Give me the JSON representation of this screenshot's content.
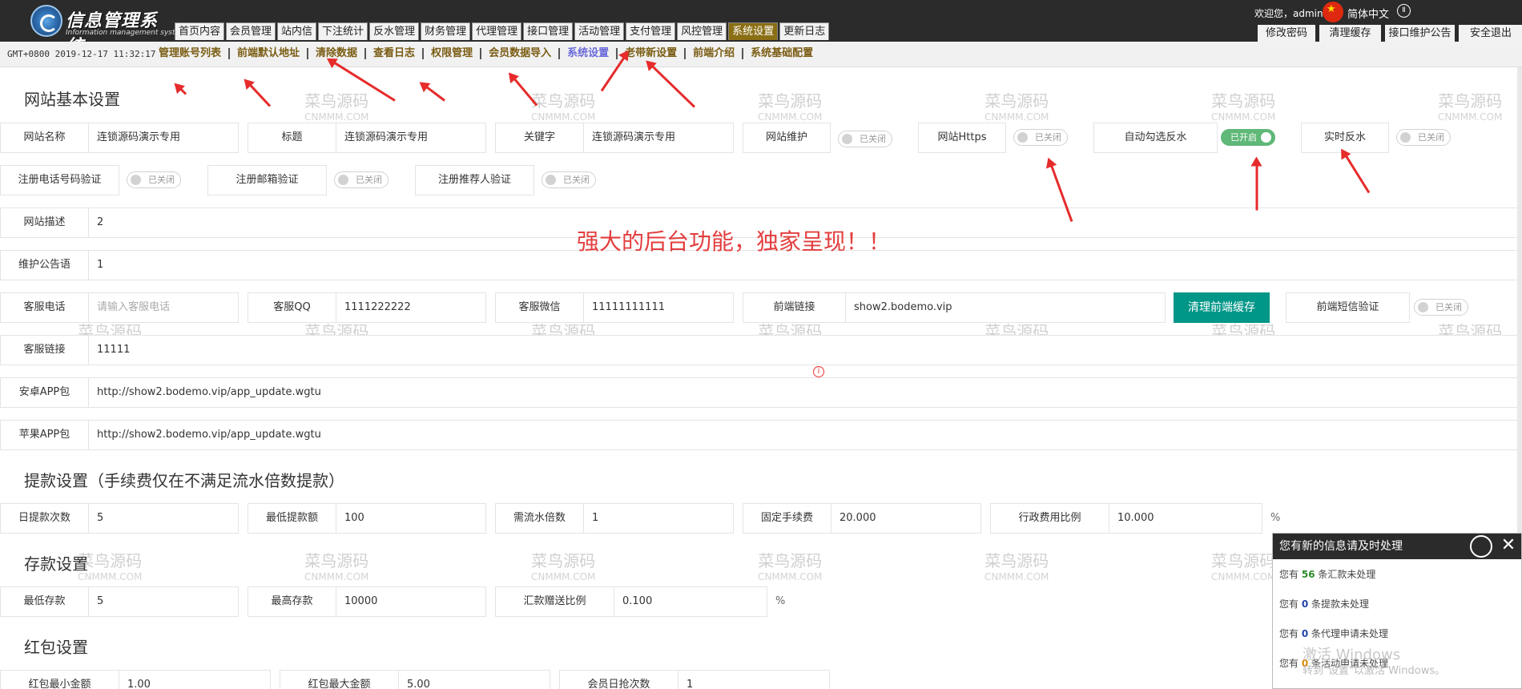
{
  "app": {
    "title": "信息管理系统",
    "subtitle": "Information management system"
  },
  "topnav": [
    "首页内容",
    "会员管理",
    "站内信",
    "下注统计",
    "反水管理",
    "财务管理",
    "代理管理",
    "接口管理",
    "活动管理",
    "支付管理",
    "风控管理",
    "系统设置",
    "更新日志"
  ],
  "user": {
    "welcome": "欢迎您，admin",
    "lang": "简体中文",
    "pause": "Ⅱ"
  },
  "top_buttons": [
    "修改密码",
    "清理缓存",
    "接口维护公告",
    "安全退出"
  ],
  "clock": "GMT+0800 2019-12-17 11:32:17",
  "subnav": [
    "管理账号列表",
    "前端默认地址",
    "清除数据",
    "查看日志",
    "权限管理",
    "会员数据导入",
    "系统设置",
    "老带新设置",
    "前端介绍",
    "系统基础配置"
  ],
  "sections": {
    "basic": "网站基本设置",
    "withdraw": "提款设置（手续费仅在不满足流水倍数提款）",
    "deposit": "存款设置",
    "redpack": "红包设置"
  },
  "basic": {
    "site_name": {
      "label": "网站名称",
      "value": "连锁源码演示专用"
    },
    "title": {
      "label": "标题",
      "value": "连锁源码演示专用"
    },
    "keywords": {
      "label": "关键字",
      "value": "连锁源码演示专用"
    },
    "maintenance": {
      "label": "网站维护",
      "state": "已关闭"
    },
    "https": {
      "label": "网站Https",
      "state": "已关闭"
    },
    "auto_rebate": {
      "label": "自动勾选反水",
      "state": "已开启"
    },
    "realtime_rebate": {
      "label": "实时反水",
      "state": "已关闭"
    },
    "phone_verify": {
      "label": "注册电话号码验证",
      "state": "已关闭"
    },
    "email_verify": {
      "label": "注册邮箱验证",
      "state": "已关闭"
    },
    "referrer_verify": {
      "label": "注册推荐人验证",
      "state": "已关闭"
    },
    "description": {
      "label": "网站描述",
      "value": "2"
    },
    "notice": {
      "label": "维护公告语",
      "value": "1"
    },
    "cs_phone": {
      "label": "客服电话",
      "placeholder": "请输入客服电话"
    },
    "cs_qq": {
      "label": "客服QQ",
      "value": "1111222222"
    },
    "cs_wechat": {
      "label": "客服微信",
      "value": "11111111111"
    },
    "frontend_link": {
      "label": "前端链接",
      "value": "show2.bodemo.vip"
    },
    "clear_frontend_cache": "清理前端缓存",
    "frontend_sms": {
      "label": "前端短信验证",
      "state": "已关闭"
    },
    "cs_link": {
      "label": "客服链接",
      "value": "11111"
    },
    "android_app": {
      "label": "安卓APP包",
      "value": "http://show2.bodemo.vip/app_update.wgtu"
    },
    "ios_app": {
      "label": "苹果APP包",
      "value": "http://show2.bodemo.vip/app_update.wgtu"
    }
  },
  "promo": "强大的后台功能，独家呈现！！",
  "withdraw": {
    "daily_times": {
      "label": "日提款次数",
      "value": "5"
    },
    "min_amount": {
      "label": "最低提款额",
      "value": "100"
    },
    "turnover_multiple": {
      "label": "需流水倍数",
      "value": "1"
    },
    "fixed_fee": {
      "label": "固定手续费",
      "value": "20.000"
    },
    "admin_fee_ratio": {
      "label": "行政费用比例",
      "value": "10.000",
      "suffix": "%"
    }
  },
  "deposit": {
    "min": {
      "label": "最低存款",
      "value": "5"
    },
    "max": {
      "label": "最高存款",
      "value": "10000"
    },
    "bonus_ratio": {
      "label": "汇款赠送比例",
      "value": "0.100",
      "suffix": "%"
    }
  },
  "redpack": {
    "min": {
      "label": "红包最小金额",
      "value": "1.00"
    },
    "max": {
      "label": "红包最大金额",
      "value": "5.00"
    },
    "daily_times": {
      "label": "会员日抢次数",
      "value": "1"
    }
  },
  "notice_panel": {
    "title": "您有新的信息请及时处理",
    "rows": [
      {
        "pre": "您有",
        "count": "56",
        "post": "条汇款未处理"
      },
      {
        "pre": "您有",
        "count": "0",
        "post": "条提款未处理"
      },
      {
        "pre": "您有",
        "count": "0",
        "post": "条代理申请未处理"
      },
      {
        "pre": "您有",
        "count": "0",
        "post": "条活动申请未处理"
      }
    ]
  },
  "watermark": {
    "cn": "菜鸟源码",
    "en": "CNMMM.COM"
  },
  "windows_activation": {
    "line1": "激活 Windows",
    "line2": "转到\"设置\"以激活 Windows。"
  },
  "colors": {
    "topbar": "#2b2b2b",
    "active_tab": "#8a6f14",
    "toggle_on": "#5fb878",
    "primary_button": "#009688",
    "promo": "#e33e3e"
  }
}
